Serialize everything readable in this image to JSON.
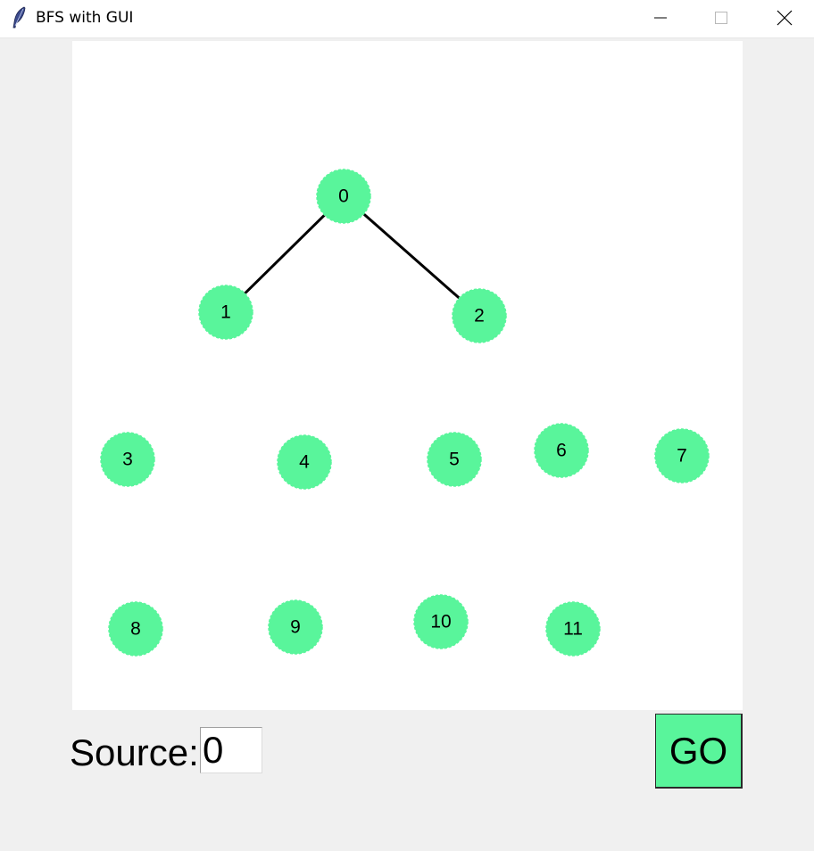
{
  "window": {
    "title": "BFS with GUI",
    "controls": [
      "minimize",
      "maximize",
      "close"
    ]
  },
  "graph": {
    "node_color": "#59f59b",
    "edge_color": "#000000",
    "nodes": [
      {
        "id": "0",
        "label": "0"
      },
      {
        "id": "1",
        "label": "1"
      },
      {
        "id": "2",
        "label": "2"
      },
      {
        "id": "3",
        "label": "3"
      },
      {
        "id": "4",
        "label": "4"
      },
      {
        "id": "5",
        "label": "5"
      },
      {
        "id": "6",
        "label": "6"
      },
      {
        "id": "7",
        "label": "7"
      },
      {
        "id": "8",
        "label": "8"
      },
      {
        "id": "9",
        "label": "9"
      },
      {
        "id": "10",
        "label": "10"
      },
      {
        "id": "11",
        "label": "11"
      }
    ],
    "edges": [
      {
        "from": "0",
        "to": "1"
      },
      {
        "from": "0",
        "to": "2"
      }
    ]
  },
  "controls": {
    "source_label": "Source:",
    "source_value": "0",
    "go_label": "GO",
    "accent": "#59f59b"
  }
}
